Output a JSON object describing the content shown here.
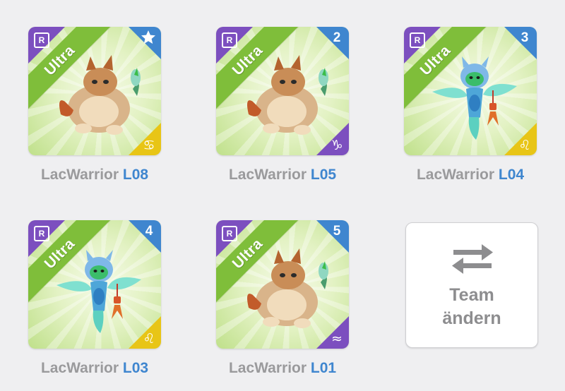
{
  "cards": [
    {
      "rarity": "Ultra",
      "rarity_badge": "R",
      "slot": "star",
      "name": "LacWarrior",
      "level": "L08",
      "zodiac": "♋",
      "zodiac_name": "cancer-icon",
      "zodiac_color": "#e8c516",
      "monster": "fire-monster"
    },
    {
      "rarity": "Ultra",
      "rarity_badge": "R",
      "slot": "2",
      "name": "LacWarrior",
      "level": "L05",
      "zodiac": "♑",
      "zodiac_name": "capricorn-icon",
      "zodiac_color": "#7c4fbf",
      "monster": "fire-monster"
    },
    {
      "rarity": "Ultra",
      "rarity_badge": "R",
      "slot": "3",
      "name": "LacWarrior",
      "level": "L04",
      "zodiac": "♌",
      "zodiac_name": "leo-icon",
      "zodiac_color": "#e8c516",
      "monster": "water-monster"
    },
    {
      "rarity": "Ultra",
      "rarity_badge": "R",
      "slot": "4",
      "name": "LacWarrior",
      "level": "L03",
      "zodiac": "♌",
      "zodiac_name": "leo-icon",
      "zodiac_color": "#e8c516",
      "monster": "water-monster"
    },
    {
      "rarity": "Ultra",
      "rarity_badge": "R",
      "slot": "5",
      "name": "LacWarrior",
      "level": "L01",
      "zodiac": "≈",
      "zodiac_name": "aquarius-icon",
      "zodiac_color": "#7c4fbf",
      "monster": "fire-monster"
    }
  ],
  "team_button": {
    "line1": "Team",
    "line2": "ändern",
    "icon": "swap-arrows-icon"
  },
  "colors": {
    "level": "#3f86cf",
    "name": "#9a9a9c",
    "ribbon": "#7fbe3a",
    "purple": "#7c4fbf",
    "blue": "#3f86cf",
    "yellow": "#e8c516"
  }
}
